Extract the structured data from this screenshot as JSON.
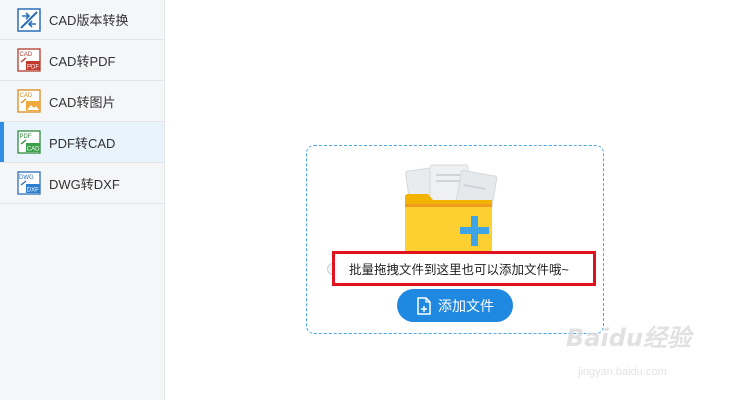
{
  "sidebar": {
    "items": [
      {
        "label": "CAD版本转换",
        "icon": "cad-version-icon",
        "active": false
      },
      {
        "label": "CAD转PDF",
        "icon": "cad-to-pdf-icon",
        "active": false
      },
      {
        "label": "CAD转图片",
        "icon": "cad-to-image-icon",
        "active": false
      },
      {
        "label": "PDF转CAD",
        "icon": "pdf-to-cad-icon",
        "active": true
      },
      {
        "label": "DWG转DXF",
        "icon": "dwg-to-dxf-icon",
        "active": false
      }
    ],
    "icon_tags": {
      "cad": "CAD",
      "pdf": "PDF",
      "dwg": "DWG",
      "dxf": "DXF"
    }
  },
  "dropzone": {
    "hint": "批量拖拽文件到这里也可以添加文件哦~",
    "add_button_label": "添加文件",
    "icon": "folder-plus-icon"
  },
  "watermark": {
    "brand": "Baidu经验",
    "url": "jingyan.baidu.com"
  },
  "colors": {
    "accent": "#1f88e0",
    "highlight_border": "#e0121f",
    "active_bg": "#e9f3fc",
    "folder": "#fbcf2c",
    "plus": "#3fa4e6"
  }
}
